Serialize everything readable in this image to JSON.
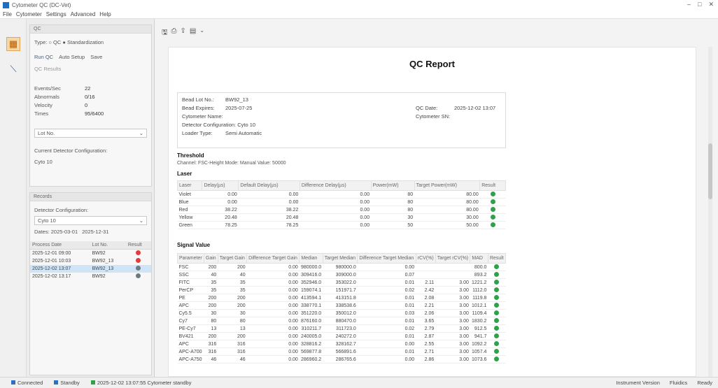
{
  "window": {
    "title": "Cytometer QC (DC-Vet)",
    "controls": [
      "–",
      "□",
      "✕"
    ]
  },
  "menu": [
    "File",
    "Cytometer",
    "Settings",
    "Advanced",
    "Help"
  ],
  "left_panel": {
    "top_section": {
      "title": "QC",
      "type_label": "Type: ○ QC  ● Standardization",
      "run_button": "Run QC",
      "secondary_button": "Auto Setup",
      "tertiary_button": "Save",
      "sub_label": "QC Results",
      "fields": [
        {
          "key": "Events/Sec",
          "value": "22"
        },
        {
          "key": "Abnormals",
          "value": "0/16"
        },
        {
          "key": "Velocity",
          "value": "0"
        },
        {
          "key": "Times",
          "value": "95/6400"
        }
      ],
      "lot_combo": "Lot No.",
      "config_label": "Current Detector Configuration:",
      "config_value": "Cyto 10"
    },
    "bottom_section": {
      "title": "Records",
      "config_label": "Detector Configuration:",
      "config_combo": "Cyto 10",
      "date_from": "Dates: 2025-03-01",
      "date_to": "2025-12-31",
      "table_headers": [
        "Process Date",
        "Lot No.",
        "Result"
      ],
      "rows": [
        {
          "date": "2025-12-01 09:00",
          "lot": "BW92",
          "result": "red",
          "selected": false
        },
        {
          "date": "2025-12-01 10:03",
          "lot": "BW92_13",
          "result": "red",
          "selected": false
        },
        {
          "date": "2025-12-02 13:07",
          "lot": "BW92_13",
          "result": "gray",
          "selected": true
        },
        {
          "date": "2025-12-02 13:17",
          "lot": "BW92",
          "result": "gray",
          "selected": false
        }
      ]
    }
  },
  "toolbar_icons": [
    "save-icon",
    "print-icon",
    "export-icon",
    "page-setup-icon"
  ],
  "report": {
    "title": "QC Report",
    "info": {
      "bead_lot_label": "Bead Lot No.:",
      "bead_lot": "BW92_13",
      "bead_expiry_label": "Bead Expires:",
      "bead_expiry": "2025-07-25",
      "cytometer_name_label": "Cytometer Name:",
      "detector_config_label": "Detector Configuration: Cyto 10",
      "loader_type_label": "Loader Type:",
      "loader_type": "Semi Automatic",
      "qc_date_label": "QC Date:",
      "qc_date": "2025-12-02 13:07",
      "serial_label": "Cytometer SN:"
    },
    "threshold": {
      "heading": "Threshold",
      "text": "Channel: FSC-Height   Mode: Manual   Value: 50000"
    },
    "laser": {
      "heading": "Laser",
      "headers": [
        "Laser",
        "Delay(µs)",
        "Default Delay(µs)",
        "Difference Delay(µs)",
        "Power(mW)",
        "Target Power(mW)",
        "Result"
      ],
      "rows": [
        [
          "Violet",
          "0.00",
          "0.00",
          "0.00",
          "80",
          "80.00",
          "green"
        ],
        [
          "Blue",
          "0.00",
          "0.00",
          "0.00",
          "80",
          "80.00",
          "green"
        ],
        [
          "Red",
          "38.22",
          "38.22",
          "0.00",
          "80",
          "80.00",
          "green"
        ],
        [
          "Yellow",
          "20.48",
          "20.48",
          "0.00",
          "30",
          "30.00",
          "green"
        ],
        [
          "Green",
          "78.25",
          "78.25",
          "0.00",
          "50",
          "50.00",
          "green"
        ]
      ]
    },
    "signal": {
      "heading": "Signal Value",
      "headers": [
        "Parameter",
        "Gain",
        "Target Gain",
        "Difference Target Gain",
        "Median",
        "Target Median",
        "Difference Target Median",
        "rCV(%)",
        "Target rCV(%)",
        "MAD",
        "Result"
      ],
      "rows": [
        [
          "FSC",
          "200",
          "200",
          "0.00",
          "980000.0",
          "980000.0",
          "0.00",
          "",
          "",
          "800.0",
          "green"
        ],
        [
          "SSC",
          "40",
          "40",
          "0.00",
          "309416.0",
          "309000.0",
          "0.07",
          "",
          "",
          "893.2",
          "green"
        ],
        [
          "FITC",
          "35",
          "35",
          "0.00",
          "352946.0",
          "353022.0",
          "0.01",
          "2.11",
          "3.00",
          "1221.2",
          "green"
        ],
        [
          "PerCP",
          "35",
          "35",
          "0.00",
          "159074.1",
          "151971.7",
          "0.02",
          "2.42",
          "3.00",
          "1112.0",
          "green"
        ],
        [
          "PE",
          "200",
          "200",
          "0.00",
          "413594.1",
          "413151.8",
          "0.01",
          "2.08",
          "3.00",
          "1119.8",
          "green"
        ],
        [
          "APC",
          "200",
          "200",
          "0.00",
          "338770.1",
          "338538.6",
          "0.01",
          "2.21",
          "3.00",
          "1012.1",
          "green"
        ],
        [
          "Cy5.5",
          "30",
          "30",
          "0.00",
          "351220.0",
          "350012.0",
          "0.03",
          "2.06",
          "3.00",
          "1109.4",
          "green"
        ],
        [
          "Cy7",
          "80",
          "80",
          "0.00",
          "876160.0",
          "880470.0",
          "0.01",
          "3.65",
          "3.00",
          "1830.2",
          "green"
        ],
        [
          "PE-Cy7",
          "13",
          "13",
          "0.00",
          "310211.7",
          "311723.0",
          "0.02",
          "2.79",
          "3.00",
          "912.5",
          "green"
        ],
        [
          "BV421",
          "200",
          "200",
          "0.00",
          "240005.0",
          "240272.0",
          "0.01",
          "2.87",
          "3.00",
          "941.7",
          "green"
        ],
        [
          "APC",
          "316",
          "316",
          "0.00",
          "328816.2",
          "328162.7",
          "0.00",
          "2.55",
          "3.00",
          "1092.2",
          "green"
        ],
        [
          "APC-A700",
          "316",
          "316",
          "0.00",
          "569877.8",
          "566891.6",
          "0.01",
          "2.71",
          "3.00",
          "1057.4",
          "green"
        ],
        [
          "APC-A750",
          "46",
          "46",
          "0.00",
          "286960.2",
          "286765.6",
          "0.00",
          "2.86",
          "3.00",
          "1073.6",
          "green"
        ]
      ]
    }
  },
  "status_bar": {
    "left": [
      "Connected",
      "Standby",
      "2025-12-02 13:07:55 Cytometer standby"
    ],
    "right": [
      "Instrument Version",
      "Fluidics",
      "Ready"
    ]
  }
}
